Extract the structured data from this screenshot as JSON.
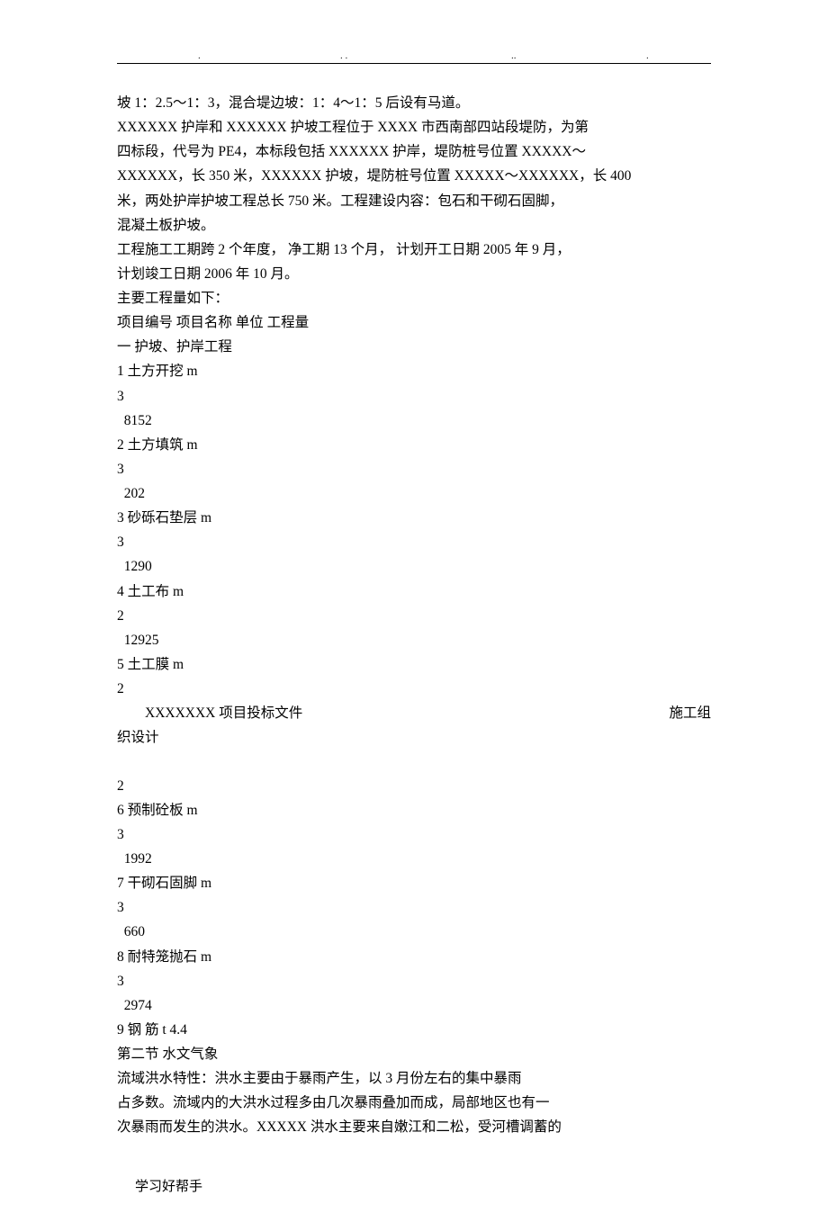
{
  "header": {
    "d1": ".",
    "d2": ". .",
    "d3": "..",
    "d4": "."
  },
  "lines": {
    "l1": "坡 1：2.5～1：3，混合堤边坡：1：4～1：5 后设有马道。",
    "l2": "XXXXXX 护岸和 XXXXXX 护坡工程位于 XXXX 市西南部四站段堤防，为第",
    "l3": "四标段，代号为 PE4，本标段包括 XXXXXX 护岸，堤防桩号位置 XXXXX～",
    "l4": "XXXXXX，长 350 米，XXXXXX 护坡，堤防桩号位置 XXXXX～XXXXXX，长 400",
    "l5": "米，两处护岸护坡工程总长 750 米。工程建设内容：包石和干砌石固脚，",
    "l6": "混凝土板护坡。",
    "l7": "工程施工工期跨 2 个年度，  净工期 13 个月，  计划开工日期 2005 年 9 月，",
    "l8": "计划竣工日期 2006 年 10 月。",
    "l9": "主要工程量如下：",
    "l10": "项目编号  项目名称  单位  工程量",
    "l11": "一  护坡、护岸工程",
    "l12": "1  土方开挖  m",
    "l13": "3",
    "l14": "  8152",
    "l15": "2  土方填筑  m",
    "l16": "3",
    "l17": "  202",
    "l18": "3  砂砾石垫层  m",
    "l19": "3",
    "l20": "  1290",
    "l21": "4  土工布  m",
    "l22": "2",
    "l23": "  12925",
    "l24": "5  土工膜  m",
    "l25": "2",
    "projL": "XXXXXXX 项目投标文件",
    "projR": "施工组",
    "l26": "织设计",
    "l27": "2",
    "l28": "6  预制砼板  m",
    "l29": "3",
    "l30": "  1992",
    "l31": "7  干砌石固脚  m",
    "l32": "3",
    "l33": "  660",
    "l34": "8  耐特笼抛石  m",
    "l35": "3",
    "l36": "  2974",
    "l37": "9  钢    筋  t 4.4",
    "sec2": "第二节    水文气象",
    "l38": "流域洪水特性：洪水主要由于暴雨产生，以 3 月份左右的集中暴雨",
    "l39": "占多数。流域内的大洪水过程多由几次暴雨叠加而成，局部地区也有一",
    "l40": "次暴雨而发生的洪水。XXXXX 洪水主要来自嫩江和二松，受河槽调蓄的"
  },
  "footer": "学习好帮手"
}
